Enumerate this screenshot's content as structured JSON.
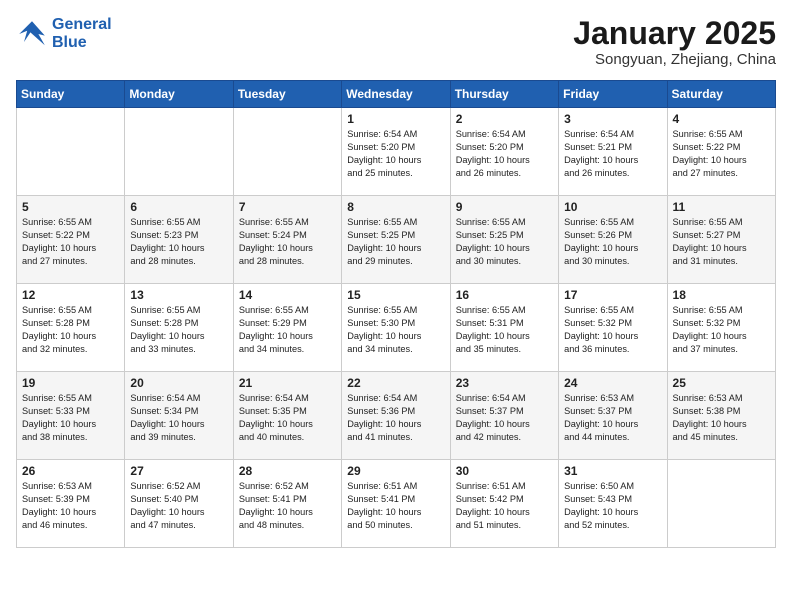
{
  "logo": {
    "line1": "General",
    "line2": "Blue"
  },
  "calendar": {
    "title": "January 2025",
    "subtitle": "Songyuan, Zhejiang, China"
  },
  "weekdays": [
    "Sunday",
    "Monday",
    "Tuesday",
    "Wednesday",
    "Thursday",
    "Friday",
    "Saturday"
  ],
  "weeks": [
    [
      {
        "day": "",
        "info": ""
      },
      {
        "day": "",
        "info": ""
      },
      {
        "day": "",
        "info": ""
      },
      {
        "day": "1",
        "info": "Sunrise: 6:54 AM\nSunset: 5:20 PM\nDaylight: 10 hours\nand 25 minutes."
      },
      {
        "day": "2",
        "info": "Sunrise: 6:54 AM\nSunset: 5:20 PM\nDaylight: 10 hours\nand 26 minutes."
      },
      {
        "day": "3",
        "info": "Sunrise: 6:54 AM\nSunset: 5:21 PM\nDaylight: 10 hours\nand 26 minutes."
      },
      {
        "day": "4",
        "info": "Sunrise: 6:55 AM\nSunset: 5:22 PM\nDaylight: 10 hours\nand 27 minutes."
      }
    ],
    [
      {
        "day": "5",
        "info": "Sunrise: 6:55 AM\nSunset: 5:22 PM\nDaylight: 10 hours\nand 27 minutes."
      },
      {
        "day": "6",
        "info": "Sunrise: 6:55 AM\nSunset: 5:23 PM\nDaylight: 10 hours\nand 28 minutes."
      },
      {
        "day": "7",
        "info": "Sunrise: 6:55 AM\nSunset: 5:24 PM\nDaylight: 10 hours\nand 28 minutes."
      },
      {
        "day": "8",
        "info": "Sunrise: 6:55 AM\nSunset: 5:25 PM\nDaylight: 10 hours\nand 29 minutes."
      },
      {
        "day": "9",
        "info": "Sunrise: 6:55 AM\nSunset: 5:25 PM\nDaylight: 10 hours\nand 30 minutes."
      },
      {
        "day": "10",
        "info": "Sunrise: 6:55 AM\nSunset: 5:26 PM\nDaylight: 10 hours\nand 30 minutes."
      },
      {
        "day": "11",
        "info": "Sunrise: 6:55 AM\nSunset: 5:27 PM\nDaylight: 10 hours\nand 31 minutes."
      }
    ],
    [
      {
        "day": "12",
        "info": "Sunrise: 6:55 AM\nSunset: 5:28 PM\nDaylight: 10 hours\nand 32 minutes."
      },
      {
        "day": "13",
        "info": "Sunrise: 6:55 AM\nSunset: 5:28 PM\nDaylight: 10 hours\nand 33 minutes."
      },
      {
        "day": "14",
        "info": "Sunrise: 6:55 AM\nSunset: 5:29 PM\nDaylight: 10 hours\nand 34 minutes."
      },
      {
        "day": "15",
        "info": "Sunrise: 6:55 AM\nSunset: 5:30 PM\nDaylight: 10 hours\nand 34 minutes."
      },
      {
        "day": "16",
        "info": "Sunrise: 6:55 AM\nSunset: 5:31 PM\nDaylight: 10 hours\nand 35 minutes."
      },
      {
        "day": "17",
        "info": "Sunrise: 6:55 AM\nSunset: 5:32 PM\nDaylight: 10 hours\nand 36 minutes."
      },
      {
        "day": "18",
        "info": "Sunrise: 6:55 AM\nSunset: 5:32 PM\nDaylight: 10 hours\nand 37 minutes."
      }
    ],
    [
      {
        "day": "19",
        "info": "Sunrise: 6:55 AM\nSunset: 5:33 PM\nDaylight: 10 hours\nand 38 minutes."
      },
      {
        "day": "20",
        "info": "Sunrise: 6:54 AM\nSunset: 5:34 PM\nDaylight: 10 hours\nand 39 minutes."
      },
      {
        "day": "21",
        "info": "Sunrise: 6:54 AM\nSunset: 5:35 PM\nDaylight: 10 hours\nand 40 minutes."
      },
      {
        "day": "22",
        "info": "Sunrise: 6:54 AM\nSunset: 5:36 PM\nDaylight: 10 hours\nand 41 minutes."
      },
      {
        "day": "23",
        "info": "Sunrise: 6:54 AM\nSunset: 5:37 PM\nDaylight: 10 hours\nand 42 minutes."
      },
      {
        "day": "24",
        "info": "Sunrise: 6:53 AM\nSunset: 5:37 PM\nDaylight: 10 hours\nand 44 minutes."
      },
      {
        "day": "25",
        "info": "Sunrise: 6:53 AM\nSunset: 5:38 PM\nDaylight: 10 hours\nand 45 minutes."
      }
    ],
    [
      {
        "day": "26",
        "info": "Sunrise: 6:53 AM\nSunset: 5:39 PM\nDaylight: 10 hours\nand 46 minutes."
      },
      {
        "day": "27",
        "info": "Sunrise: 6:52 AM\nSunset: 5:40 PM\nDaylight: 10 hours\nand 47 minutes."
      },
      {
        "day": "28",
        "info": "Sunrise: 6:52 AM\nSunset: 5:41 PM\nDaylight: 10 hours\nand 48 minutes."
      },
      {
        "day": "29",
        "info": "Sunrise: 6:51 AM\nSunset: 5:41 PM\nDaylight: 10 hours\nand 50 minutes."
      },
      {
        "day": "30",
        "info": "Sunrise: 6:51 AM\nSunset: 5:42 PM\nDaylight: 10 hours\nand 51 minutes."
      },
      {
        "day": "31",
        "info": "Sunrise: 6:50 AM\nSunset: 5:43 PM\nDaylight: 10 hours\nand 52 minutes."
      },
      {
        "day": "",
        "info": ""
      }
    ]
  ]
}
